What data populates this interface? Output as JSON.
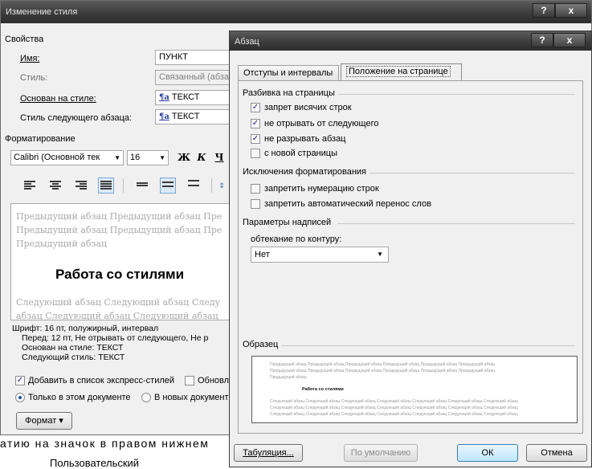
{
  "bg": {
    "title": "Изменение стиля",
    "help": "?",
    "close": "x",
    "props_header": "Свойства",
    "name_label": "Имя:",
    "name_value": "ПУНКТ",
    "style_label": "Стиль:",
    "style_value": "Связанный (абзац",
    "based_label": "Основан на стиле:",
    "based_value": "ТЕКСТ",
    "next_label": "Стиль следующего абзаца:",
    "next_value": "ТЕКСТ",
    "style_mark": "¶a",
    "format_header": "Форматирование",
    "font_value": "Calibri (Основной тек",
    "size_value": "16",
    "bold": "Ж",
    "italic": "К",
    "underline": "Ч",
    "preview_prev1": "Предыдущий абзац Предыдущий абзац Пре",
    "preview_prev2": "Предыдущий абзац Предыдущий абзац Пре",
    "preview_prev3": "Предыдущий абзац",
    "preview_sample": "Работа со стилями",
    "preview_next1": "Следующий абзац Следующий абзац Следу",
    "preview_next2": "абзац Следующий абзац Следующий абзац",
    "desc1": "Шрифт: 16 пт, полужирный, интервал",
    "desc2": "Перед:  12 пт, Не отрывать от следующего, Не р",
    "desc3": "Основан на стиле: ТЕКСТ",
    "desc4": "Следующий стиль: ТЕКСТ",
    "add_quick": "Добавить в список экспресс-стилей",
    "update": "Обновл",
    "only_doc": "Только в этом документе",
    "new_docs": "В новых документ",
    "format_btn": "Формат ▾"
  },
  "doc_text": {
    "line1": "атию на значок в правом нижнем",
    "line2": "Пользовательский"
  },
  "fg": {
    "title": "Абзац",
    "help": "?",
    "close": "x",
    "tab1": "Отступы и интервалы",
    "tab2": "Положение на странице",
    "pagination": "Разбивка на страницы",
    "opt1": "запрет висячих строк",
    "opt2": "не отрывать от следующего",
    "opt3": "не разрывать абзац",
    "opt4": "с новой страницы",
    "exceptions": "Исключения форматирования",
    "opt5": "запретить нумерацию строк",
    "opt6": "запретить автоматический перенос слов",
    "textbox": "Параметры надписей",
    "wrap_label": "обтекание по контуру:",
    "wrap_value": "Нет",
    "sample_label": "Образец",
    "sample_prev": "Предыдущий абзац Предыдущий абзац Предыдущий абзац Предыдущий абзац Предыдущий абзац Предыдущий абзац",
    "sample_prev3": "Предыдущий абзац",
    "sample_text": "Работа со стилями",
    "sample_next": "Следующий абзац Следующий абзац Следующий абзац Следующий абзац Следующий абзац Следующий абзац Следующий абзац",
    "tabs_btn": "Табуляция...",
    "default_btn": "По умолчанию",
    "ok_btn": "ОК",
    "cancel_btn": "Отмена"
  }
}
